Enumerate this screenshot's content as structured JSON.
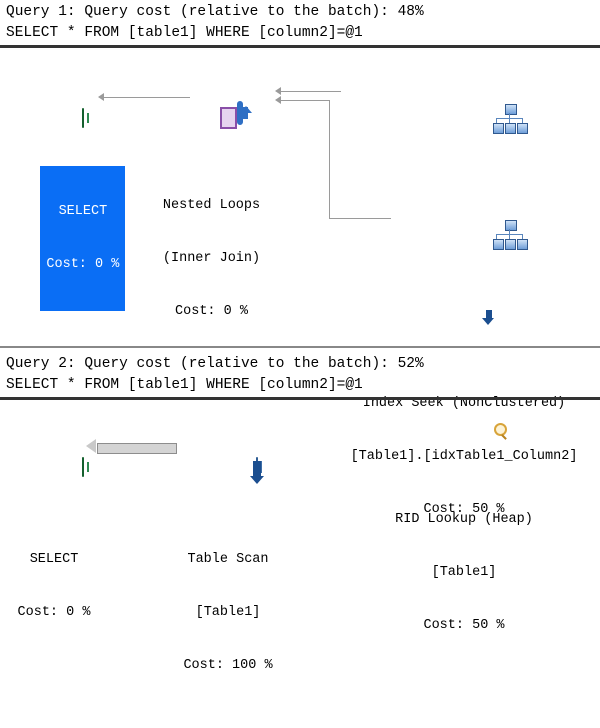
{
  "queries": [
    {
      "header": "Query 1: Query cost (relative to the batch): 48%",
      "sql": "SELECT * FROM [table1] WHERE [column2]=@1",
      "nodes": [
        {
          "id": "select-1",
          "icon": "result-grid-icon",
          "selected": true,
          "lines": [
            "SELECT",
            "Cost: 0 %"
          ]
        },
        {
          "id": "nested-loops",
          "icon": "nested-loops-icon",
          "selected": false,
          "lines": [
            "Nested Loops",
            "(Inner Join)",
            "Cost: 0 %"
          ]
        },
        {
          "id": "index-seek",
          "icon": "index-seek-icon",
          "selected": false,
          "lines": [
            "Index Seek (NonClustered)",
            "[Table1].[idxTable1_Column2]",
            "Cost: 50 %"
          ]
        },
        {
          "id": "rid-lookup",
          "icon": "rid-lookup-icon",
          "selected": false,
          "lines": [
            "RID Lookup (Heap)",
            "[Table1]",
            "Cost: 50 %"
          ]
        }
      ]
    },
    {
      "header": "Query 2: Query cost (relative to the batch): 52%",
      "sql": "SELECT * FROM [table1] WHERE [column2]=@1",
      "nodes": [
        {
          "id": "select-2",
          "icon": "result-grid-icon",
          "selected": false,
          "lines": [
            "SELECT",
            "Cost: 0 %"
          ]
        },
        {
          "id": "table-scan",
          "icon": "table-scan-icon",
          "selected": false,
          "lines": [
            "Table Scan",
            "[Table1]",
            "Cost: 100 %"
          ]
        }
      ]
    }
  ],
  "colors": {
    "selection_blue": "#0a6ef5",
    "connector_gray": "#9a9a9a",
    "rule_dark": "#333333",
    "divider_gray": "#888888"
  }
}
